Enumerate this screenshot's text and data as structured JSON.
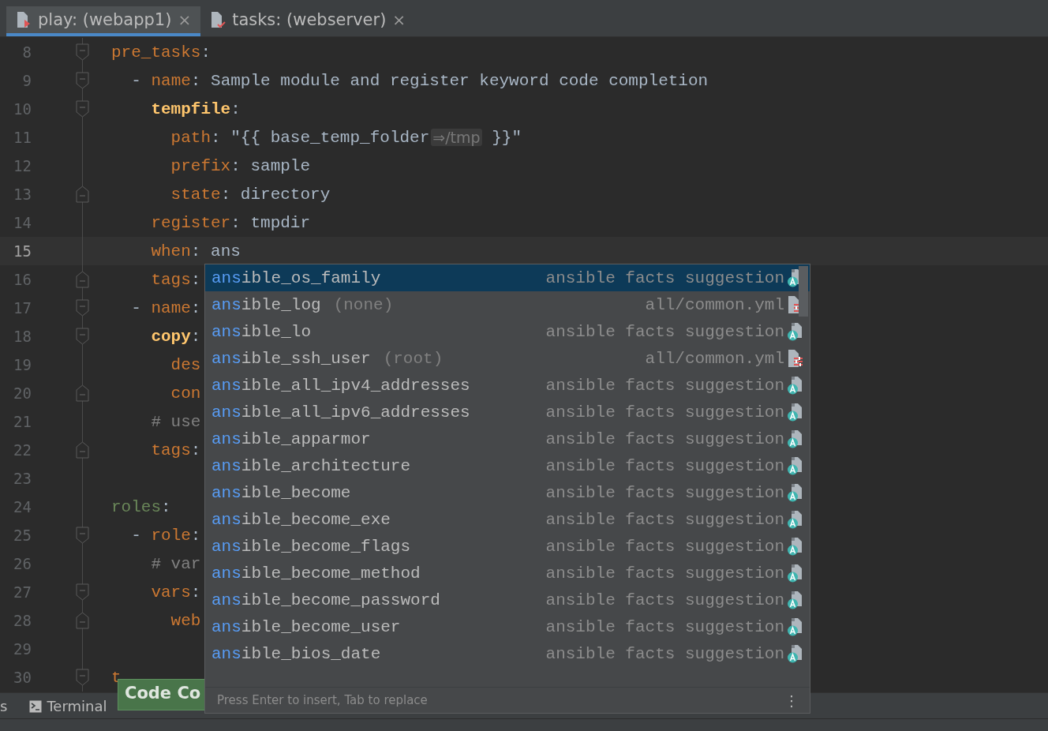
{
  "tabs": [
    {
      "label": "play: (webapp1)",
      "kind": "playbook",
      "selected": true,
      "close": "×"
    },
    {
      "label": "tasks: (webserver)",
      "kind": "tasks",
      "selected": false,
      "close": "×"
    }
  ],
  "editor": {
    "lines": [
      {
        "number": "8",
        "fold_start": true,
        "current": false,
        "tokens": [
          {
            "kind": "section",
            "text": "pre_tasks"
          },
          {
            "kind": "colon",
            "text": ":"
          }
        ],
        "children": [
          {
            "number": "9",
            "fold_start": true,
            "current": false,
            "tokens": [
              {
                "kind": "dash",
                "text": "- "
              },
              {
                "kind": "key",
                "text": "name"
              },
              {
                "kind": "colon",
                "text": ": "
              },
              {
                "kind": "value",
                "text": "Sample module and register keyword code completion"
              }
            ],
            "children": [
              {
                "number": "10",
                "fold_start": true,
                "current": false,
                "tokens": [
                  {
                    "kind": "module",
                    "text": "tempfile"
                  },
                  {
                    "kind": "colon",
                    "text": ":"
                  }
                ],
                "children": [
                  {
                    "number": "11",
                    "fold_start": false,
                    "fold_end": false,
                    "current": false,
                    "tokens": [
                      {
                        "kind": "key",
                        "text": "path"
                      },
                      {
                        "kind": "colon",
                        "text": ": "
                      },
                      {
                        "kind": "value",
                        "text": "\"{{ base_temp_folder"
                      },
                      {
                        "kind": "hint",
                        "text": "⇒/tmp"
                      },
                      {
                        "kind": "value",
                        "text": " }}\""
                      }
                    ]
                  },
                  {
                    "number": "12",
                    "fold_start": false,
                    "fold_end": false,
                    "current": false,
                    "tokens": [
                      {
                        "kind": "key",
                        "text": "prefix"
                      },
                      {
                        "kind": "colon",
                        "text": ": "
                      },
                      {
                        "kind": "value",
                        "text": "sample"
                      }
                    ]
                  },
                  {
                    "number": "13",
                    "fold_start": false,
                    "fold_end": true,
                    "current": false,
                    "tokens": [
                      {
                        "kind": "key",
                        "text": "state"
                      },
                      {
                        "kind": "colon",
                        "text": ": "
                      },
                      {
                        "kind": "value",
                        "text": "directory"
                      }
                    ]
                  }
                ]
              },
              {
                "number": "14",
                "fold_start": false,
                "fold_end": false,
                "current": false,
                "tokens": [
                  {
                    "kind": "key",
                    "text": "register"
                  },
                  {
                    "kind": "colon",
                    "text": ": "
                  },
                  {
                    "kind": "value",
                    "text": "tmpdir"
                  }
                ]
              },
              {
                "number": "15",
                "fold_start": false,
                "fold_end": false,
                "current": true,
                "tokens": [
                  {
                    "kind": "key",
                    "text": "when"
                  },
                  {
                    "kind": "colon",
                    "text": ": "
                  },
                  {
                    "kind": "value",
                    "text": "ans"
                  }
                ]
              },
              {
                "number": "16",
                "fold_start": false,
                "fold_end": true,
                "current": false,
                "tokens": [
                  {
                    "kind": "key",
                    "text": "tags"
                  },
                  {
                    "kind": "colon",
                    "text": ":"
                  }
                ]
              }
            ]
          },
          {
            "number": "17",
            "fold_start": true,
            "current": false,
            "tokens": [
              {
                "kind": "dash",
                "text": "- "
              },
              {
                "kind": "key",
                "text": "name"
              },
              {
                "kind": "colon",
                "text": ":"
              }
            ],
            "children": [
              {
                "number": "18",
                "fold_start": true,
                "current": false,
                "tokens": [
                  {
                    "kind": "module",
                    "text": "copy"
                  },
                  {
                    "kind": "colon",
                    "text": ":"
                  }
                ],
                "children": [
                  {
                    "number": "19",
                    "fold_start": false,
                    "fold_end": false,
                    "current": false,
                    "tokens": [
                      {
                        "kind": "key",
                        "text": "des"
                      }
                    ]
                  },
                  {
                    "number": "20",
                    "fold_start": false,
                    "fold_end": true,
                    "current": false,
                    "tokens": [
                      {
                        "kind": "key",
                        "text": "con"
                      }
                    ]
                  }
                ]
              },
              {
                "number": "21",
                "fold_start": false,
                "fold_end": false,
                "current": false,
                "tokens": [
                  {
                    "kind": "comment",
                    "text": "# use"
                  }
                ]
              },
              {
                "number": "22",
                "fold_start": false,
                "fold_end": true,
                "current": false,
                "tokens": [
                  {
                    "kind": "key",
                    "text": "tags"
                  },
                  {
                    "kind": "colon",
                    "text": ":"
                  }
                ]
              }
            ]
          }
        ]
      },
      {
        "number": "23",
        "fold_start": false,
        "fold_end": false,
        "current": false
      },
      {
        "number": "24",
        "fold_start": false,
        "fold_end": false,
        "current": false,
        "tokens": [
          {
            "kind": "section2",
            "text": "roles"
          },
          {
            "kind": "colon",
            "text": ":"
          }
        ],
        "children": [
          {
            "number": "25",
            "fold_start": true,
            "current": false,
            "tokens": [
              {
                "kind": "dash",
                "text": "- "
              },
              {
                "kind": "key",
                "text": "role"
              },
              {
                "kind": "colon",
                "text": ":"
              }
            ],
            "children": [
              {
                "number": "26",
                "fold_start": false,
                "fold_end": false,
                "current": false,
                "tokens": [
                  {
                    "kind": "comment",
                    "text": "# var"
                  }
                ]
              },
              {
                "number": "27",
                "fold_start": true,
                "current": false,
                "tokens": [
                  {
                    "kind": "key",
                    "text": "vars"
                  },
                  {
                    "kind": "colon",
                    "text": ":"
                  }
                ],
                "children": [
                  {
                    "number": "28",
                    "fold_start": false,
                    "fold_end": true,
                    "current": false,
                    "tokens": [
                      {
                        "kind": "key",
                        "text": "web"
                      }
                    ]
                  }
                ]
              }
            ]
          }
        ]
      },
      {
        "number": "29",
        "fold_start": false,
        "fold_end": false,
        "current": false
      },
      {
        "number": "30",
        "fold_start": true,
        "current": false,
        "tokens": [
          {
            "kind": "section",
            "text": "t"
          }
        ]
      }
    ]
  },
  "completion": {
    "items": [
      {
        "match": "ans",
        "rest": "ible_os_family",
        "type": "ansible facts suggestion",
        "kind": "fact",
        "selected": true
      },
      {
        "match": "ans",
        "rest": "ible_log",
        "detail": "(none)",
        "type": "all/common.yml",
        "kind": "var",
        "selected": false
      },
      {
        "match": "ans",
        "rest": "ible_lo",
        "type": "ansible facts suggestion",
        "kind": "fact",
        "selected": false
      },
      {
        "match": "ans",
        "rest": "ible_ssh_user",
        "detail": "(root)",
        "type": "all/common.yml",
        "kind": "var",
        "selected": false
      },
      {
        "match": "ans",
        "rest": "ible_all_ipv4_addresses",
        "type": "ansible facts suggestion",
        "kind": "fact",
        "selected": false
      },
      {
        "match": "ans",
        "rest": "ible_all_ipv6_addresses",
        "type": "ansible facts suggestion",
        "kind": "fact",
        "selected": false
      },
      {
        "match": "ans",
        "rest": "ible_apparmor",
        "type": "ansible facts suggestion",
        "kind": "fact",
        "selected": false
      },
      {
        "match": "ans",
        "rest": "ible_architecture",
        "type": "ansible facts suggestion",
        "kind": "fact",
        "selected": false
      },
      {
        "match": "ans",
        "rest": "ible_become",
        "type": "ansible facts suggestion",
        "kind": "fact",
        "selected": false
      },
      {
        "match": "ans",
        "rest": "ible_become_exe",
        "type": "ansible facts suggestion",
        "kind": "fact",
        "selected": false
      },
      {
        "match": "ans",
        "rest": "ible_become_flags",
        "type": "ansible facts suggestion",
        "kind": "fact",
        "selected": false
      },
      {
        "match": "ans",
        "rest": "ible_become_method",
        "type": "ansible facts suggestion",
        "kind": "fact",
        "selected": false
      },
      {
        "match": "ans",
        "rest": "ible_become_password",
        "type": "ansible facts suggestion",
        "kind": "fact",
        "selected": false
      },
      {
        "match": "ans",
        "rest": "ible_become_user",
        "type": "ansible facts suggestion",
        "kind": "fact",
        "selected": false
      },
      {
        "match": "ans",
        "rest": "ible_bios_date",
        "type": "ansible facts suggestion",
        "kind": "fact",
        "selected": false
      }
    ],
    "footer": "Press Enter to insert, Tab to replace",
    "menu": "⋮"
  },
  "tool_windows": [
    {
      "label": "s",
      "kind": "plain"
    },
    {
      "label": "Terminal",
      "kind": "terminal"
    }
  ],
  "tooltip": "Code Co"
}
